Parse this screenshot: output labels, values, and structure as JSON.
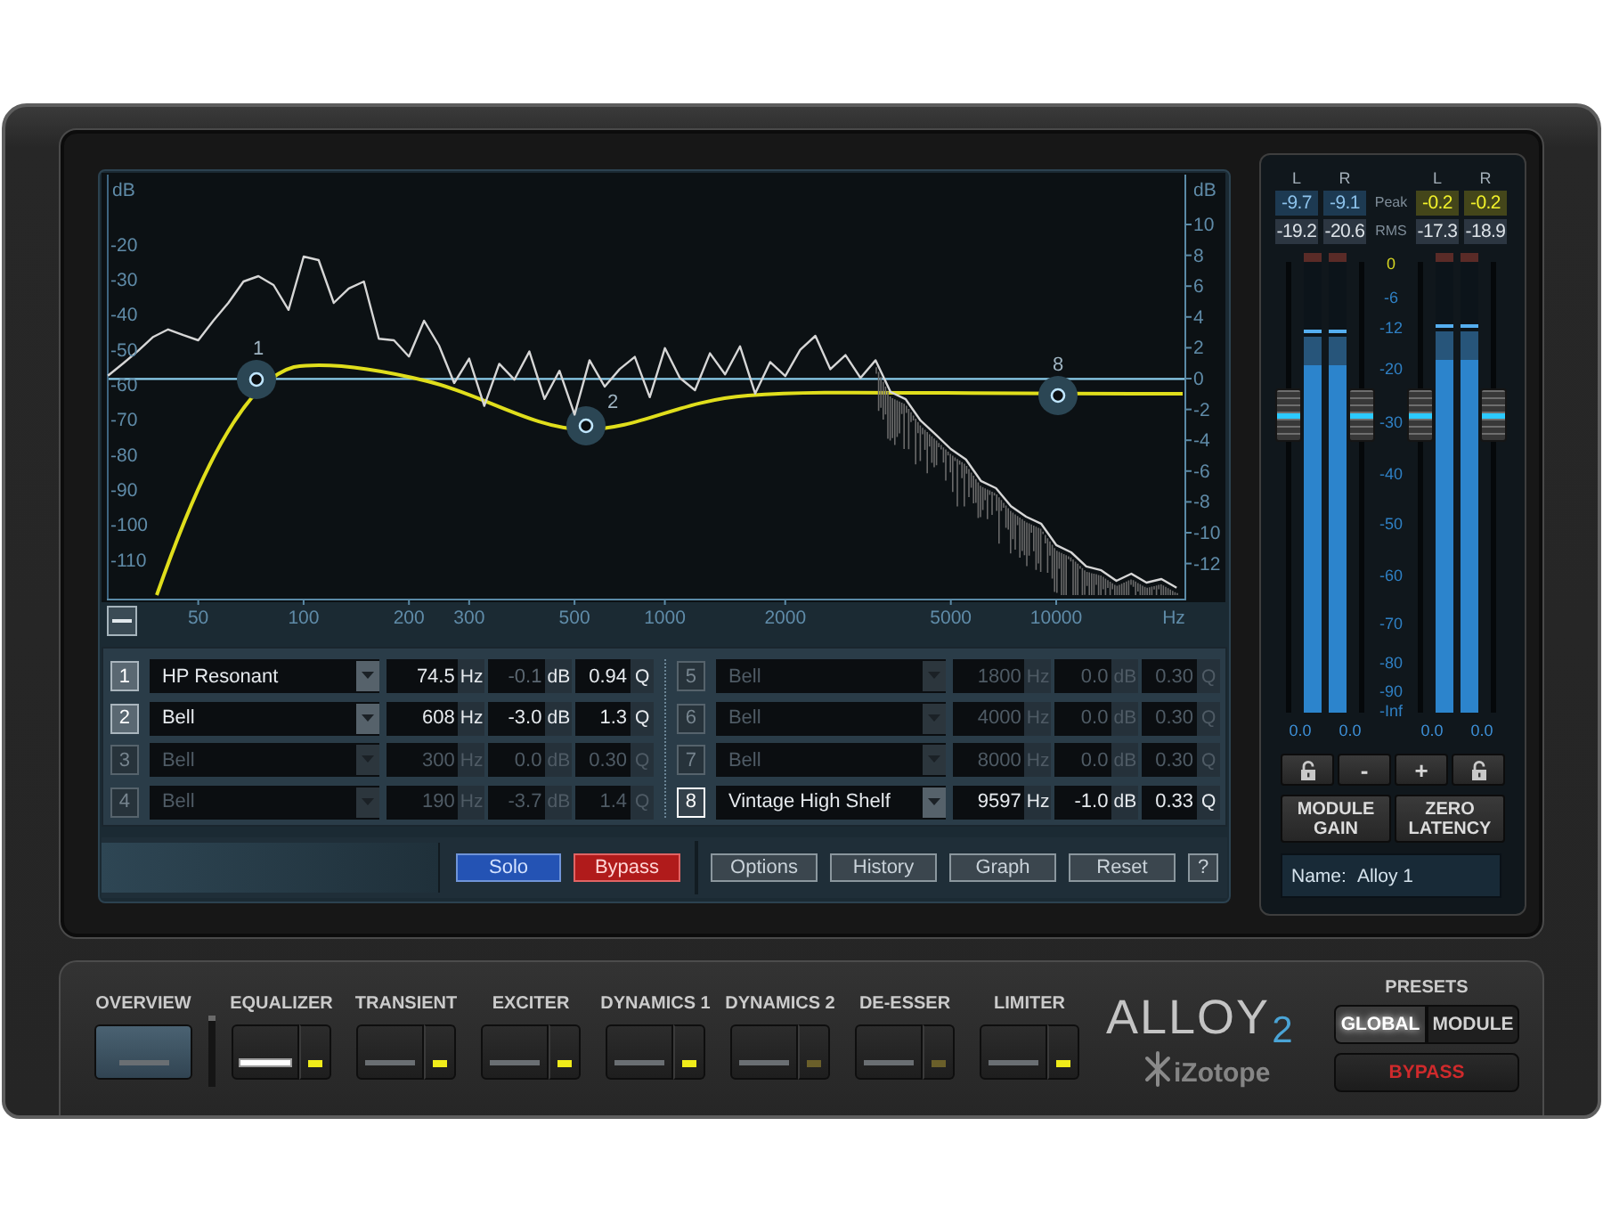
{
  "equalizer": {
    "graph": {
      "chart_data": {
        "type": "line",
        "xlabel": "Hz",
        "ylabel": "dB",
        "categories": [
          null,
          null,
          null,
          null,
          null,
          null,
          "50",
          null,
          null,
          null,
          null,
          null,
          null,
          "100",
          null,
          null,
          null,
          null,
          null,
          null,
          "200",
          null,
          null,
          null,
          "300",
          null,
          null,
          null,
          null,
          null,
          null,
          "500",
          null,
          null,
          null,
          null,
          null,
          "1000",
          null,
          null,
          null,
          null,
          null,
          null,
          null,
          "2000",
          null,
          null,
          null,
          null,
          null,
          null,
          null,
          null,
          null,
          null,
          "5000",
          null,
          null,
          null,
          null,
          null,
          null,
          "10000",
          null,
          null,
          null,
          null,
          null,
          null,
          null,
          null
        ],
        "ylim": [
          -121,
          0
        ],
        "yticks": [
          -20,
          -30,
          -40,
          -50,
          -60,
          -70,
          -80,
          -90,
          -100,
          -110
        ],
        "ref_lines": [
          {
            "axis": "y",
            "value": -58.3,
            "color": "#8ccfee"
          }
        ],
        "series": [
          {
            "color": "#d6d6d6",
            "values": [
              -57.4,
              -53.9,
              -50.3,
              -46.3,
              -44.2,
              -45.8,
              -47.3,
              -41.7,
              -36.6,
              -30.5,
              -29.0,
              -31.5,
              -38.6,
              -23.4,
              -24.4,
              -36.6,
              -32.5,
              -30.5,
              -46.8,
              -47.3,
              -51.9,
              -41.7,
              -48.8,
              -59.5,
              -52.5,
              -66.0,
              -54.0,
              -58.5,
              -50.5,
              -64.0,
              -56.0,
              -68.5,
              -53.0,
              -60.5,
              -55.5,
              -52.0,
              -63.5,
              -49.5,
              -58.0,
              -61.5,
              -51.0,
              -57.0,
              -49.0,
              -62.5,
              -53.5,
              -57.5,
              -50.0,
              -46.0,
              -55.5,
              -51.5,
              -58.0,
              -53.0,
              -62.0,
              -64.1,
              -70.2,
              -74.2,
              -78.3,
              -81.3,
              -87.4,
              -89.5,
              -94.6,
              -97.6,
              -99.6,
              -105.7,
              -107.8,
              -111.8,
              -112.9,
              -115.9,
              -113.9,
              -116.4,
              -115.4,
              -117.9
            ]
          }
        ]
      },
      "right_axis": {
        "unit": "dB",
        "ticks": [
          "10",
          "8",
          "6",
          "4",
          "2",
          "0",
          "-2",
          "-4",
          "-6",
          "-8",
          "-10",
          "-12"
        ]
      },
      "nodes": [
        {
          "label": "1"
        },
        {
          "label": "2"
        },
        {
          "label": "8"
        }
      ]
    },
    "bands": [
      {
        "number": "1",
        "type": "HP Resonant",
        "frequency": "74.5",
        "frequency_unit": "Hz",
        "gain": "-0.1",
        "gain_unit": "dB",
        "q": "0.94",
        "q_unit": "Q",
        "enabled": true,
        "selected": false,
        "gain_enabled": false
      },
      {
        "number": "2",
        "type": "Bell",
        "frequency": "608",
        "frequency_unit": "Hz",
        "gain": "-3.0",
        "gain_unit": "dB",
        "q": "1.3",
        "q_unit": "Q",
        "enabled": true,
        "selected": false,
        "gain_enabled": true
      },
      {
        "number": "3",
        "type": "Bell",
        "frequency": "300",
        "frequency_unit": "Hz",
        "gain": "0.0",
        "gain_unit": "dB",
        "q": "0.30",
        "q_unit": "Q",
        "enabled": false,
        "selected": false
      },
      {
        "number": "4",
        "type": "Bell",
        "frequency": "190",
        "frequency_unit": "Hz",
        "gain": "-3.7",
        "gain_unit": "dB",
        "q": "1.4",
        "q_unit": "Q",
        "enabled": false,
        "selected": false
      },
      {
        "number": "5",
        "type": "Bell",
        "frequency": "1800",
        "frequency_unit": "Hz",
        "gain": "0.0",
        "gain_unit": "dB",
        "q": "0.30",
        "q_unit": "Q",
        "enabled": false,
        "selected": false
      },
      {
        "number": "6",
        "type": "Bell",
        "frequency": "4000",
        "frequency_unit": "Hz",
        "gain": "0.0",
        "gain_unit": "dB",
        "q": "0.30",
        "q_unit": "Q",
        "enabled": false,
        "selected": false
      },
      {
        "number": "7",
        "type": "Bell",
        "frequency": "8000",
        "frequency_unit": "Hz",
        "gain": "0.0",
        "gain_unit": "dB",
        "q": "0.30",
        "q_unit": "Q",
        "enabled": false,
        "selected": false
      },
      {
        "number": "8",
        "type": "Vintage High Shelf",
        "frequency": "9597",
        "frequency_unit": "Hz",
        "gain": "-1.0",
        "gain_unit": "dB",
        "q": "0.33",
        "q_unit": "Q",
        "enabled": true,
        "selected": true,
        "gain_enabled": true
      }
    ],
    "buttons": [
      {
        "label": "Solo",
        "kind": "solo"
      },
      {
        "label": "Bypass",
        "kind": "bypass"
      },
      {
        "label": "Options",
        "kind": "plain"
      },
      {
        "label": "History",
        "kind": "plain"
      },
      {
        "label": "Graph",
        "kind": "plain"
      },
      {
        "label": "Reset",
        "kind": "plain"
      },
      {
        "label": "?",
        "kind": "help"
      }
    ]
  },
  "meters": {
    "groups": [
      {
        "channels": [
          {
            "label": "L",
            "peak": "-9.7",
            "rms": "-19.2",
            "peak_hot": false,
            "level": 0.85
          },
          {
            "label": "R",
            "peak": "-9.1",
            "rms": "-20.6",
            "peak_hot": false,
            "level": 0.85
          }
        ],
        "faders": [
          {
            "level": 0.66,
            "readout": "0.0"
          },
          {
            "level": 0.66,
            "readout": "0.0"
          }
        ]
      },
      {
        "channels": [
          {
            "label": "L",
            "peak": "-0.2",
            "rms": "-17.3",
            "peak_hot": true,
            "level": 0.86
          },
          {
            "label": "R",
            "peak": "-0.2",
            "rms": "-18.9",
            "peak_hot": true,
            "level": 0.86
          }
        ],
        "faders": [
          {
            "level": 0.66,
            "readout": "0.0"
          },
          {
            "level": 0.66,
            "readout": "0.0"
          }
        ]
      }
    ],
    "peak_label": "Peak",
    "rms_label": "RMS",
    "scale": [
      "0",
      "-6",
      "-12",
      "-20",
      "-30",
      "-40",
      "-50",
      "-60",
      "-70",
      "-80",
      "-90",
      "-Inf"
    ],
    "controls": [
      {
        "kind": "lock"
      },
      {
        "kind": "minus",
        "label": "-"
      },
      {
        "kind": "plus",
        "label": "+"
      },
      {
        "kind": "lock"
      }
    ],
    "buttons": [
      {
        "label": "MODULE GAIN"
      },
      {
        "label": "ZERO LATENCY"
      }
    ],
    "name_field": {
      "label": "Name:",
      "value": "Alloy 1"
    }
  },
  "module_bar": {
    "overview": {
      "label": "OVERVIEW"
    },
    "modules": [
      {
        "label": "EQUALIZER",
        "selected": true,
        "on": true
      },
      {
        "label": "TRANSIENT",
        "selected": false,
        "on": true
      },
      {
        "label": "EXCITER",
        "selected": false,
        "on": true
      },
      {
        "label": "DYNAMICS 1",
        "selected": false,
        "on": true
      },
      {
        "label": "DYNAMICS 2",
        "selected": false,
        "on": false
      },
      {
        "label": "DE-ESSER",
        "selected": false,
        "on": false
      },
      {
        "label": "LIMITER",
        "selected": false,
        "on": true
      }
    ]
  },
  "logo": {
    "name": "ALLOY",
    "version": "2",
    "brand": "iZotope"
  },
  "presets": {
    "title": "PRESETS",
    "scopes": [
      {
        "label": "GLOBAL",
        "selected": true
      },
      {
        "label": "MODULE",
        "selected": false
      }
    ],
    "bypass": {
      "label": "BYPASS"
    }
  }
}
